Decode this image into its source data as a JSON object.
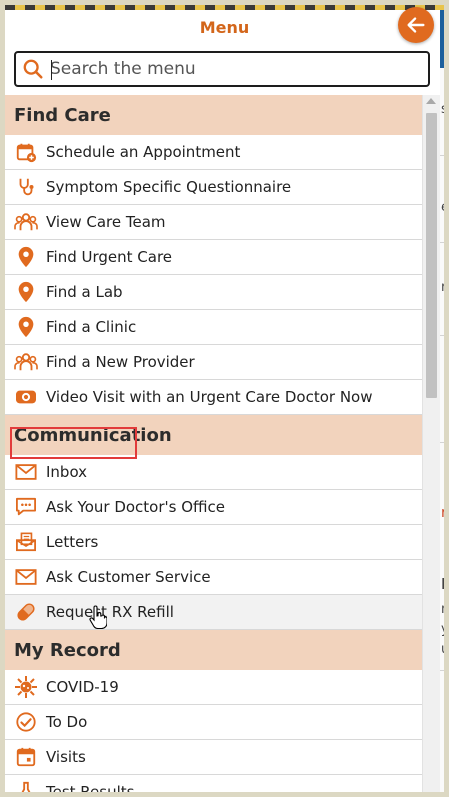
{
  "header": {
    "title": "Menu",
    "back_icon": "arrow-left-icon",
    "accent_color": "#e06a1f"
  },
  "search": {
    "placeholder": "Search the menu",
    "icon": "search-icon"
  },
  "sections": [
    {
      "title": "Find Care",
      "items": [
        {
          "label": "Schedule an Appointment",
          "icon": "calendar-add-icon"
        },
        {
          "label": "Symptom Specific Questionnaire",
          "icon": "stethoscope-icon"
        },
        {
          "label": "View Care Team",
          "icon": "team-icon"
        },
        {
          "label": "Find Urgent Care",
          "icon": "location-pin-icon"
        },
        {
          "label": "Find a Lab",
          "icon": "location-pin-icon"
        },
        {
          "label": "Find a Clinic",
          "icon": "location-pin-icon"
        },
        {
          "label": "Find a New Provider",
          "icon": "team-icon"
        },
        {
          "label": "Video Visit with an Urgent Care Doctor Now",
          "icon": "webcam-icon"
        }
      ]
    },
    {
      "title": "Communication",
      "items": [
        {
          "label": "Inbox",
          "icon": "envelope-icon"
        },
        {
          "label": "Ask Your Doctor's Office",
          "icon": "chat-bubble-icon"
        },
        {
          "label": "Letters",
          "icon": "letter-icon",
          "highlighted": true
        },
        {
          "label": "Ask Customer Service",
          "icon": "envelope-icon"
        },
        {
          "label": "Request RX Refill",
          "icon": "pill-icon",
          "hovered": true
        }
      ]
    },
    {
      "title": "My Record",
      "items": [
        {
          "label": "COVID-19",
          "icon": "virus-icon"
        },
        {
          "label": "To Do",
          "icon": "checkmark-clock-icon"
        },
        {
          "label": "Visits",
          "icon": "calendar-icon"
        },
        {
          "label": "Test Results",
          "icon": "flask-icon"
        }
      ]
    }
  ],
  "background_fragments": [
    "si",
    "e",
    "re",
    "r",
    "H",
    "n",
    "y",
    "u"
  ]
}
